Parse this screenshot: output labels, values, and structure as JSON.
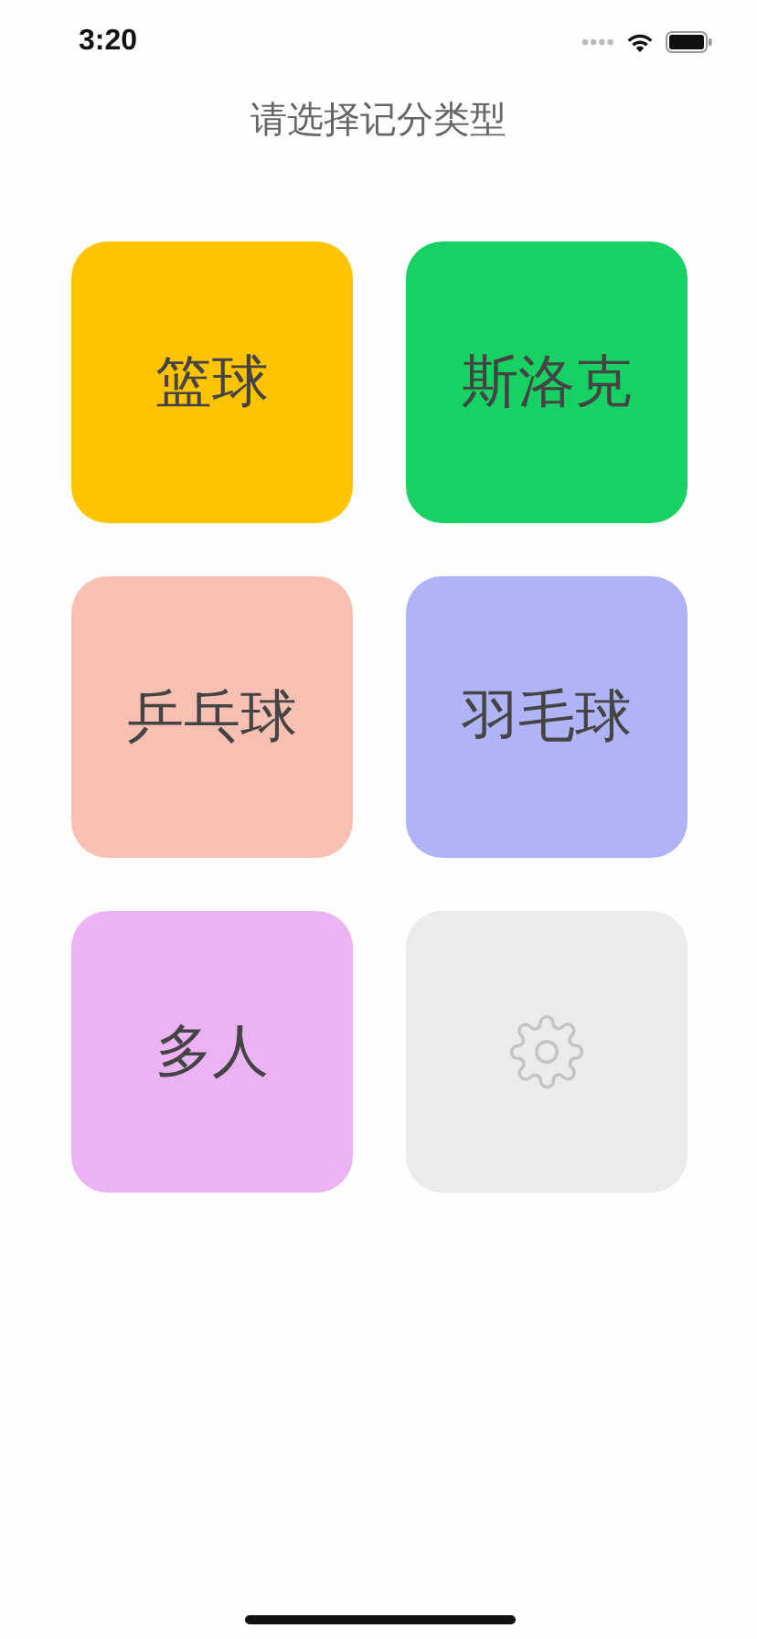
{
  "status_bar": {
    "time": "3:20"
  },
  "title": "请选择记分类型",
  "tiles": [
    {
      "kind": "label",
      "label": "篮球",
      "color": "#ffc300"
    },
    {
      "kind": "label",
      "label": "斯洛克",
      "color": "#17d162"
    },
    {
      "kind": "label",
      "label": "乒乓球",
      "color": "#f8c0b3"
    },
    {
      "kind": "label",
      "label": "羽毛球",
      "color": "#b0b3f6"
    },
    {
      "kind": "label",
      "label": "多人",
      "color": "#ebb3f3"
    },
    {
      "kind": "settings",
      "color": "#ebebeb"
    }
  ]
}
